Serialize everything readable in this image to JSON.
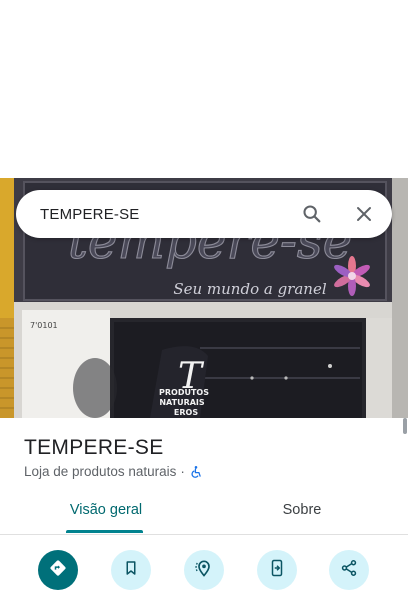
{
  "search": {
    "query": "TEMPERE-SE"
  },
  "photo": {
    "sign_brand": "tempere-se",
    "sign_slogan": "Seu mundo a granel",
    "house_number": "7'0101",
    "flag_letter": "T",
    "flag_line1": "PRODUTOS",
    "flag_line2": "NATURAIS",
    "flag_line3": "EROS"
  },
  "place": {
    "title": "TEMPERE-SE",
    "category": "Loja de produtos naturais",
    "separator": "·",
    "accessibility_icon": "wheelchair-icon"
  },
  "tabs": [
    {
      "label": "Visão geral",
      "active": true
    },
    {
      "label": "Sobre",
      "active": false
    }
  ],
  "actions": [
    {
      "icon": "directions-icon",
      "primary": true
    },
    {
      "icon": "bookmark-icon",
      "primary": false
    },
    {
      "icon": "nearby-icon",
      "primary": false
    },
    {
      "icon": "send-to-phone-icon",
      "primary": false
    },
    {
      "icon": "share-icon",
      "primary": false
    }
  ],
  "colors": {
    "accent": "#01838f",
    "action_bg": "#d4f3fa",
    "primary_action": "#00707a"
  }
}
